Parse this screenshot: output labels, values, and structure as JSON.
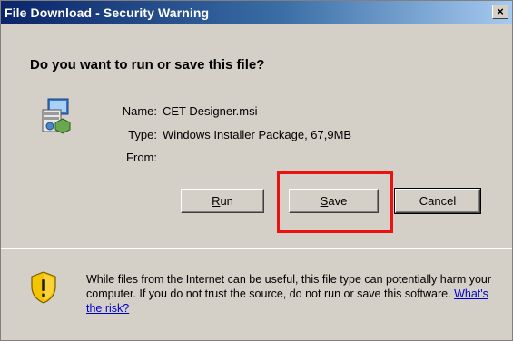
{
  "window": {
    "title": "File Download - Security Warning",
    "close_label": "×"
  },
  "question": "Do you want to run or save this file?",
  "file": {
    "name_label": "Name:",
    "name_value": "CET Designer.msi",
    "type_label": "Type:",
    "type_value": "Windows Installer Package, 67,9MB",
    "from_label": "From:",
    "from_value": ""
  },
  "buttons": {
    "run_mnemonic": "R",
    "run_rest": "un",
    "save_mnemonic": "S",
    "save_rest": "ave",
    "cancel": "Cancel"
  },
  "warning": {
    "text": "While files from the Internet can be useful, this file type can potentially harm your computer. If you do not trust the source, do not run or save this software.",
    "link": "What's the risk?"
  },
  "colors": {
    "highlight": "#ee1111",
    "title_gradient_start": "#0a246a",
    "shield_yellow": "#f5c400"
  },
  "icons": {
    "file": "installer-package-icon",
    "warning": "security-shield-warning-icon"
  }
}
